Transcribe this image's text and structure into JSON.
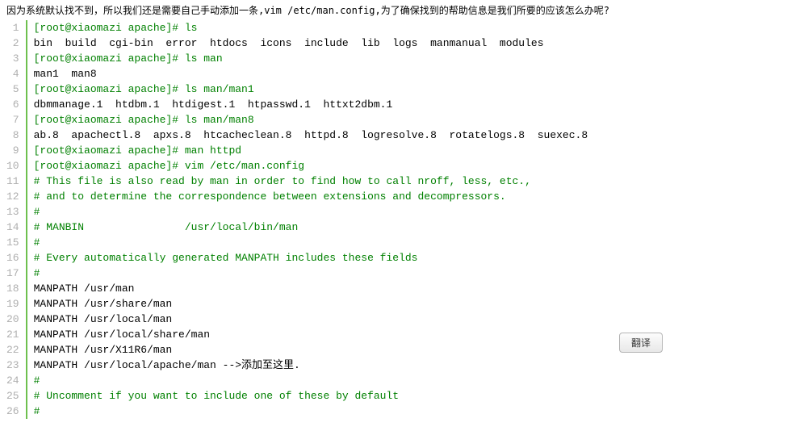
{
  "intro": {
    "part1": "因为系统默认找不到，所以我们还是需要自己手动添加一条,",
    "cmd": "vim /etc/man.config",
    "part2": ",为了确保找到的帮助信息是我们所要的应该怎么办呢?"
  },
  "button": {
    "translate": "翻译"
  },
  "lines": [
    {
      "num": "1",
      "segs": [
        [
          "prompt",
          "[root@xiaomazi apache]# "
        ],
        [
          "cmd",
          "ls"
        ]
      ]
    },
    {
      "num": "2",
      "segs": [
        [
          "plain",
          "bin  build  cgi-bin  error  htdocs  icons  include  lib  logs  manmanual  modules"
        ]
      ]
    },
    {
      "num": "3",
      "segs": [
        [
          "prompt",
          "[root@xiaomazi apache]# "
        ],
        [
          "cmd",
          "ls man"
        ]
      ]
    },
    {
      "num": "4",
      "segs": [
        [
          "plain",
          "man1  man8"
        ]
      ]
    },
    {
      "num": "5",
      "segs": [
        [
          "prompt",
          "[root@xiaomazi apache]# "
        ],
        [
          "cmd",
          "ls man/man1"
        ]
      ]
    },
    {
      "num": "6",
      "segs": [
        [
          "plain",
          "dbmmanage.1  htdbm.1  htdigest.1  htpasswd.1  httxt2dbm.1"
        ]
      ]
    },
    {
      "num": "7",
      "segs": [
        [
          "prompt",
          "[root@xiaomazi apache]# "
        ],
        [
          "cmd",
          "ls man/man8"
        ]
      ]
    },
    {
      "num": "8",
      "segs": [
        [
          "plain",
          "ab.8  apachectl.8  apxs.8  htcacheclean.8  httpd.8  logresolve.8  rotatelogs.8  suexec.8"
        ]
      ]
    },
    {
      "num": "9",
      "segs": [
        [
          "prompt",
          "[root@xiaomazi apache]# "
        ],
        [
          "cmd",
          "man httpd"
        ]
      ]
    },
    {
      "num": "10",
      "segs": [
        [
          "prompt",
          "[root@xiaomazi apache]# "
        ],
        [
          "cmd",
          "vim /etc/man.config"
        ]
      ]
    },
    {
      "num": "11",
      "segs": [
        [
          "comment",
          "# This file is also read by man in order to find how to call nroff, less, etc.,"
        ]
      ]
    },
    {
      "num": "12",
      "segs": [
        [
          "comment",
          "# and to determine the correspondence between extensions and decompressors."
        ]
      ]
    },
    {
      "num": "13",
      "segs": [
        [
          "comment",
          "#"
        ]
      ]
    },
    {
      "num": "14",
      "segs": [
        [
          "comment",
          "# MANBIN                /usr/local/bin/man"
        ]
      ]
    },
    {
      "num": "15",
      "segs": [
        [
          "comment",
          "#"
        ]
      ]
    },
    {
      "num": "16",
      "segs": [
        [
          "comment",
          "# Every automatically generated MANPATH includes these fields"
        ]
      ]
    },
    {
      "num": "17",
      "segs": [
        [
          "comment",
          "#"
        ]
      ]
    },
    {
      "num": "18",
      "segs": [
        [
          "plain",
          "MANPATH /usr/man"
        ]
      ]
    },
    {
      "num": "19",
      "segs": [
        [
          "plain",
          "MANPATH /usr/share/man"
        ]
      ]
    },
    {
      "num": "20",
      "segs": [
        [
          "plain",
          "MANPATH /usr/local/man"
        ]
      ]
    },
    {
      "num": "21",
      "segs": [
        [
          "plain",
          "MANPATH /usr/local/share/man"
        ]
      ]
    },
    {
      "num": "22",
      "segs": [
        [
          "plain",
          "MANPATH /usr/X11R6/man"
        ]
      ]
    },
    {
      "num": "23",
      "segs": [
        [
          "plain",
          "MANPATH /usr/local/apache/man -->添加至这里."
        ]
      ]
    },
    {
      "num": "24",
      "segs": [
        [
          "comment",
          "#"
        ]
      ]
    },
    {
      "num": "25",
      "segs": [
        [
          "comment",
          "# Uncomment if you want to include one of these by default"
        ]
      ]
    },
    {
      "num": "26",
      "segs": [
        [
          "comment",
          "#"
        ]
      ]
    }
  ]
}
